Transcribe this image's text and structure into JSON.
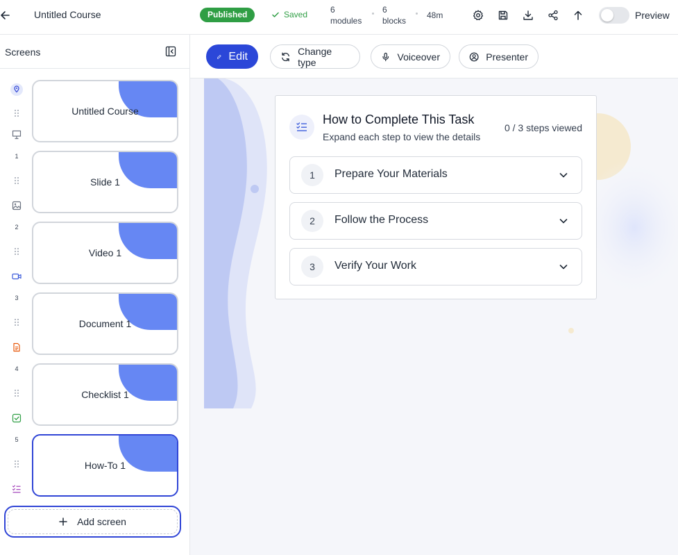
{
  "header": {
    "course_title": "Untitled Course",
    "status_badge": "Published",
    "saved_label": "Saved",
    "stats": [
      {
        "value": "6",
        "label": "modules"
      },
      {
        "value": "6",
        "label": "blocks"
      }
    ],
    "duration": "48m",
    "preview_label": "Preview",
    "preview_enabled": false,
    "icons": [
      "settings-icon",
      "save-icon",
      "download-icon",
      "share-icon",
      "publish-arrow-up-icon"
    ]
  },
  "sidebar": {
    "title": "Screens",
    "screens": [
      {
        "index": "",
        "label": "Untitled Course",
        "type_icon": "presentation-icon",
        "selected": false
      },
      {
        "index": "1",
        "label": "Slide 1",
        "type_icon": "image-icon",
        "selected": false
      },
      {
        "index": "2",
        "label": "Video 1",
        "type_icon": "video-icon",
        "selected": false
      },
      {
        "index": "3",
        "label": "Document 1",
        "type_icon": "document-icon",
        "selected": false
      },
      {
        "index": "4",
        "label": "Checklist 1",
        "type_icon": "checklist-icon",
        "selected": false
      },
      {
        "index": "5",
        "label": "How-To 1",
        "type_icon": "list-check-icon",
        "selected": true
      }
    ],
    "add_screen_label": "Add screen"
  },
  "toolbar": {
    "edit_label": "Edit",
    "change_type_label": "Change type",
    "voiceover_label": "Voiceover",
    "presenter_label": "Presenter"
  },
  "howto": {
    "title": "How to Complete This Task",
    "subtitle": "Expand each step to view the details",
    "progress": "0 / 3 steps viewed",
    "steps": [
      {
        "number": "1",
        "title": "Prepare Your Materials"
      },
      {
        "number": "2",
        "title": "Follow the Process"
      },
      {
        "number": "3",
        "title": "Verify Your Work"
      }
    ]
  },
  "colors": {
    "primary": "#2b47d8",
    "selected_border": "#3045d6",
    "card_accent": "#6687f3",
    "published_green": "#2f9e44"
  }
}
